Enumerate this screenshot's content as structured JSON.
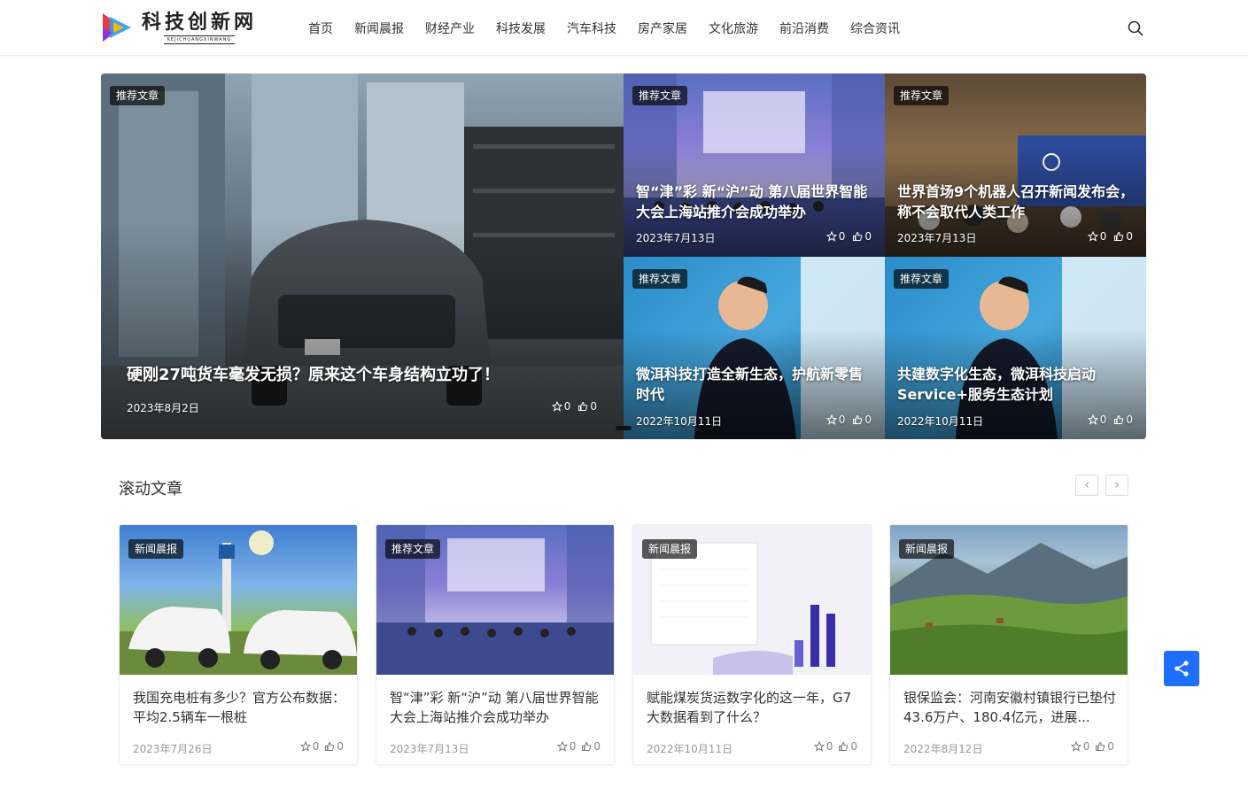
{
  "header": {
    "logo_cn": "科技创新网",
    "logo_en": "KEJICHUANGXINWANG",
    "nav": [
      "首页",
      "新闻晨报",
      "财经产业",
      "科技发展",
      "汽车科技",
      "房产家居",
      "文化旅游",
      "前沿消费",
      "综合资讯"
    ]
  },
  "hero": {
    "main": {
      "badge": "推荐文章",
      "title": "硬刚27吨货车毫发无损？原来这个车身结构立功了！",
      "date": "2023年8月2日",
      "stars": "0",
      "likes": "0"
    },
    "tiles": [
      {
        "badge": "推荐文章",
        "title": "智“津”彩 新“沪”动 第八届世界智能大会上海站推介会成功举办",
        "date": "2023年7月13日",
        "stars": "0",
        "likes": "0"
      },
      {
        "badge": "推荐文章",
        "title": "世界首场9个机器人召开新闻发布会，称不会取代人类工作",
        "date": "2023年7月13日",
        "stars": "0",
        "likes": "0"
      },
      {
        "badge": "推荐文章",
        "title": "微洱科技打造全新生态，护航新零售时代",
        "date": "2022年10月11日",
        "stars": "0",
        "likes": "0"
      },
      {
        "badge": "推荐文章",
        "title": "共建数字化生态，微洱科技启动Service+服务生态计划",
        "date": "2022年10月11日",
        "stars": "0",
        "likes": "0"
      }
    ]
  },
  "section": {
    "title": "滚动文章",
    "prev": "‹",
    "next": "›"
  },
  "cards": [
    {
      "badge": "新闻晨报",
      "title": "我国充电桩有多少？官方公布数据：平均2.5辆车一根桩",
      "date": "2023年7月26日",
      "stars": "0",
      "likes": "0"
    },
    {
      "badge": "推荐文章",
      "title": "智“津”彩 新“沪”动 第八届世界智能大会上海站推介会成功举办",
      "date": "2023年7月13日",
      "stars": "0",
      "likes": "0"
    },
    {
      "badge": "新闻晨报",
      "title": "赋能煤炭货运数字化的这一年，G7大数据看到了什么？",
      "date": "2022年10月11日",
      "stars": "0",
      "likes": "0"
    },
    {
      "badge": "新闻晨报",
      "title": "银保监会：河南安徽村镇银行已垫付43.6万户、180.4亿元，进展...",
      "date": "2022年8月12日",
      "stars": "0",
      "likes": "0"
    }
  ],
  "colors": {
    "accent": "#1e6fff",
    "badge_bg": "#000000"
  }
}
